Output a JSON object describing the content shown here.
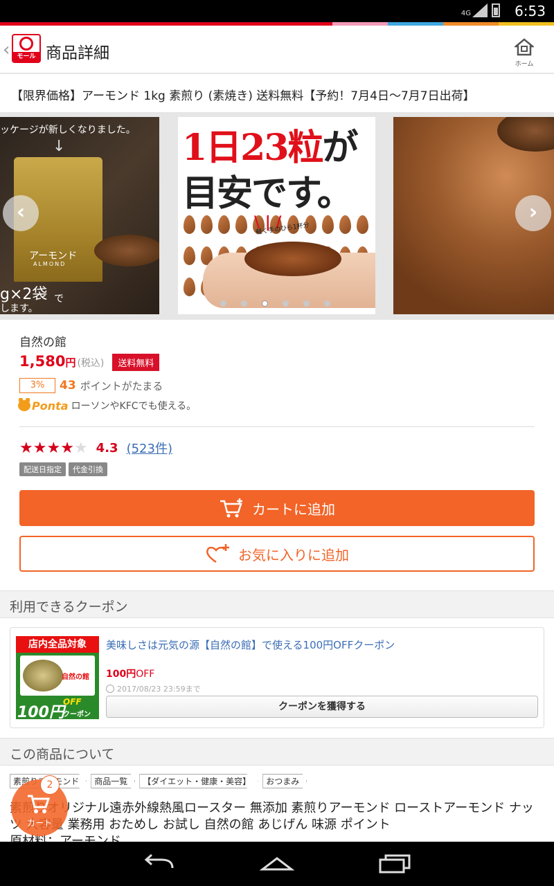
{
  "status": {
    "time": "6:53",
    "network": "4G"
  },
  "stripe_colors": [
    "#e0001a",
    "#e0001a",
    "#e0001a",
    "#e0001a",
    "#e0001a",
    "#e0001a",
    "#f29bb8",
    "#3fa7e0",
    "#f28a28",
    "#f0c020"
  ],
  "header": {
    "logo_text": "モール",
    "title": "商品詳細",
    "home_label": "ホーム"
  },
  "product": {
    "title": "【限界価格】アーモンド 1kg 素煎り (素焼き) 送料無料【予約！7月4日～7月7日出荷】",
    "shop": "自然の館",
    "price": "1,580",
    "yen": "円",
    "tax": "(税込)",
    "shipping_badge": "送料無料",
    "point_rate": "3%",
    "points": "43",
    "points_text": "ポイントがたまる",
    "ponta_logo": "Ponta",
    "ponta_text": "ローソンやKFCでも使える。",
    "rating": "4.3",
    "rating_value": 4.3,
    "reviews": "(523件)",
    "tags": [
      "配送日指定",
      "代金引換"
    ]
  },
  "carousel": {
    "slide1": {
      "caption_top": "ッケージが新しくなりました。",
      "bag_label": "アーモンド",
      "bag_sublabel": "ALMOND",
      "caption_bottom": "g×2袋",
      "caption_bottom2": "で",
      "caption_last": "します。"
    },
    "slide2": {
      "line1_red": "1日23粒",
      "line1_black": "が",
      "line2": "目安です。",
      "hand_caption": "軽く手のひら1杯分"
    },
    "dot_count": 6,
    "active_dot": 2
  },
  "actions": {
    "cart_label": "カートに追加",
    "favorite_label": "お気に入りに追加"
  },
  "coupon": {
    "section_title": "利用できるクーポン",
    "image_top": "店内全品対象",
    "image_shop": "自然の館",
    "image_big": "100円",
    "image_off": "OFF",
    "image_coupon": "クーポン",
    "title": "美味しさは元気の源【自然の館】で使える100円OFFクーポン",
    "amount": "100円",
    "amount_unit": "OFF",
    "expiry": "2017/08/23 23:59まで",
    "get_label": "クーポンを獲得する"
  },
  "about": {
    "section_title": "この商品について",
    "categories": [
      "素煎りアーモンド",
      "商品一覧",
      "【ダイエット・健康・美容】",
      "おつまみ"
    ],
    "description": "素煎りオリジナル遠赤外線熱風ロースター 無添加 素煎りアーモンド ローストアーモンド ナッツ 大容量 業務用 おためし お試し 自然の館 あじげん 味源 ポイント",
    "material": "原材料：アーモンド"
  },
  "fab": {
    "count": "2",
    "label": "カート"
  },
  "colors": {
    "accent": "#f26428",
    "price_red": "#e0001a",
    "link_blue": "#3a6db5",
    "ponta": "#f39c1a"
  }
}
